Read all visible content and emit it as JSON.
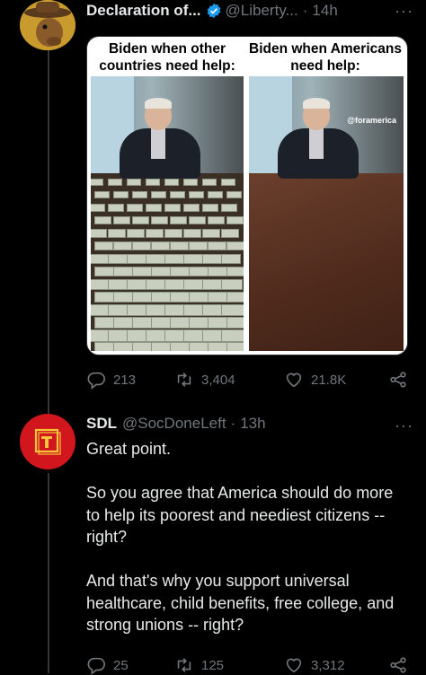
{
  "tweet1": {
    "display_name": "Declaration of...",
    "handle": "@Liberty...",
    "separator": "·",
    "time": "14h",
    "more": "···",
    "meme": {
      "left_caption": "Biden when other countries need help:",
      "right_caption": "Biden when Americans need help:",
      "watermark": "@foramerica"
    },
    "replies": "213",
    "retweets": "3,404",
    "likes": "21.8K"
  },
  "tweet2": {
    "display_name": "SDL",
    "handle": "@SocDoneLeft",
    "separator": "·",
    "time": "13h",
    "more": "···",
    "paragraphs": [
      "Great point.",
      "So you agree that America should do more to help its poorest and neediest citizens -- right?",
      "And that's why you support universal healthcare, child benefits, free college, and strong unions -- right?"
    ],
    "replies": "25",
    "retweets": "125",
    "likes": "3,312"
  },
  "colors": {
    "background": "#000000",
    "muted": "#71767b",
    "verified": "#1d9bf0",
    "avatar_red": "#d1171d"
  }
}
